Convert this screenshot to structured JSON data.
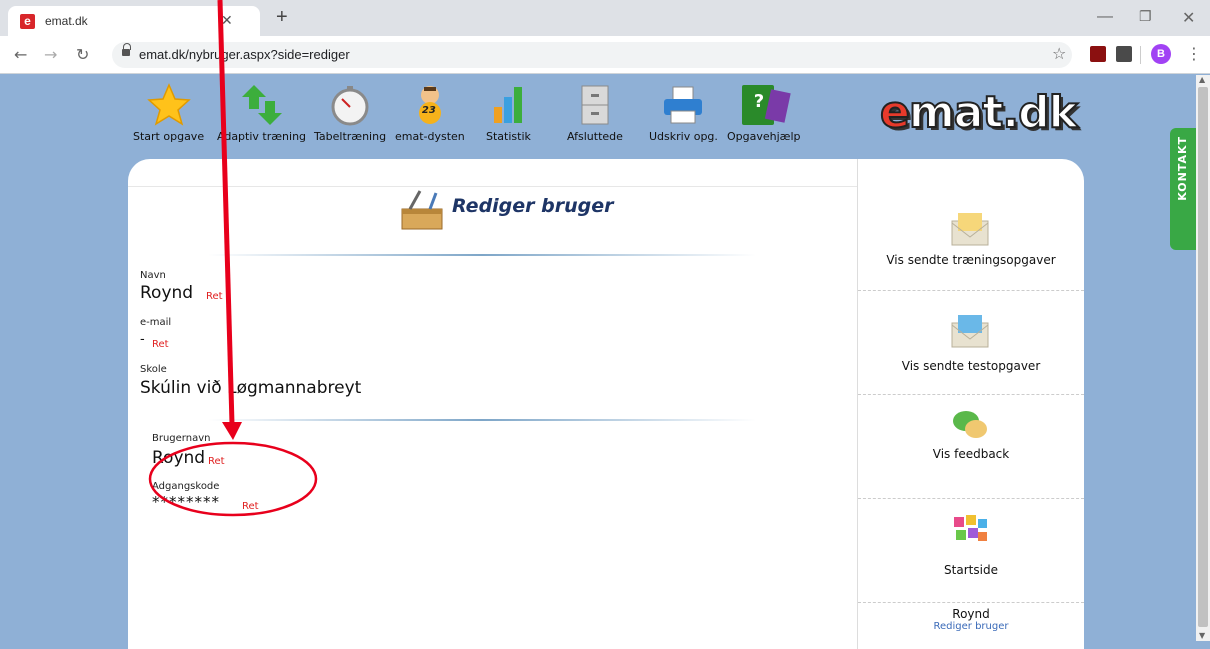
{
  "browser": {
    "tab_title": "emat.dk",
    "tab_favicon": "e",
    "url": "emat.dk/nybruger.aspx?side=rediger",
    "profile_initial": "B"
  },
  "nav": {
    "items": [
      {
        "label": "Start opgave",
        "icon": "star-icon"
      },
      {
        "label": "Adaptiv træning",
        "icon": "arrows-icon"
      },
      {
        "label": "Tabeltræning",
        "icon": "stopwatch-icon"
      },
      {
        "label": "emat-dysten",
        "icon": "character-icon"
      },
      {
        "label": "Statistik",
        "icon": "bar-chart-icon"
      },
      {
        "label": "Afsluttede",
        "icon": "cabinet-icon"
      },
      {
        "label": "Udskriv opg.",
        "icon": "printer-icon"
      },
      {
        "label": "Opgavehjælp",
        "icon": "help-book-icon"
      }
    ],
    "dysten_badge": "23",
    "help_mark": "?"
  },
  "logo": {
    "prefix": "e",
    "rest": "mat.dk"
  },
  "page": {
    "title": "Rediger bruger",
    "fields": {
      "navn_label": "Navn",
      "navn_value": "Roynd",
      "email_label": "e-mail",
      "email_value": "-",
      "skole_label": "Skole",
      "skole_value": "Skúlin við Løgmannabreyt",
      "brugernavn_label": "Brugernavn",
      "brugernavn_value": "Roynd",
      "adgangskode_label": "Adgangskode",
      "adgangskode_value": "********"
    },
    "edit_label": "Ret"
  },
  "sidebar": {
    "items": [
      {
        "label": "Vis sendte træningsopgaver",
        "icon": "envelope-yellow-icon"
      },
      {
        "label": "Vis sendte testopgaver",
        "icon": "envelope-blue-icon"
      },
      {
        "label": "Vis feedback",
        "icon": "speech-bubbles-icon"
      },
      {
        "label": "Startside",
        "icon": "colorful-tiles-icon"
      }
    ],
    "user_name": "Roynd",
    "user_link": "Rediger bruger"
  },
  "kontakt": "KONTAKT",
  "colors": {
    "page_bg": "#8fb0d6",
    "retlink": "#e02020",
    "annotation": "#e8001c",
    "kontakt": "#39a845"
  }
}
